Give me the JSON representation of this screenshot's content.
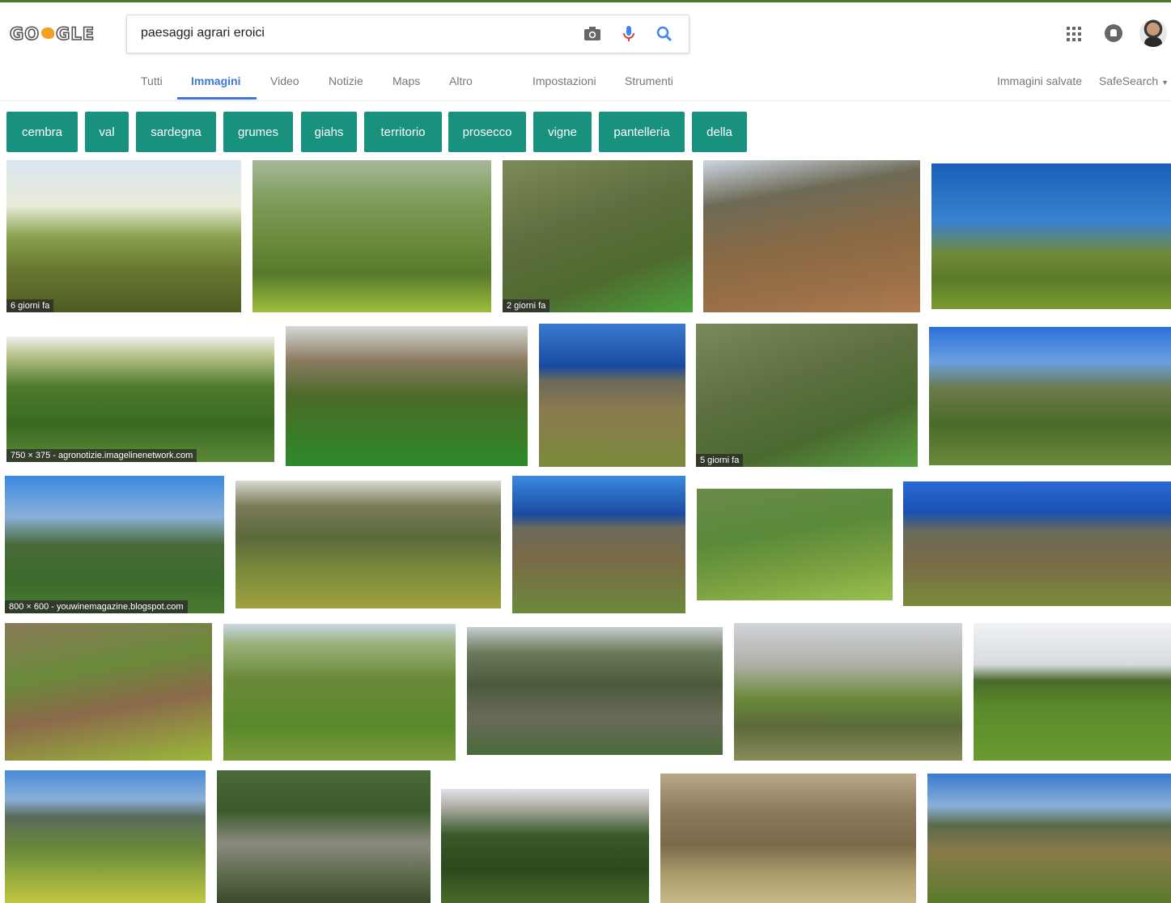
{
  "logo": {
    "text": "GO GLE"
  },
  "search": {
    "query": "paesaggi agrari eroici"
  },
  "tabs": {
    "tutti": "Tutti",
    "immagini": "Immagini",
    "video": "Video",
    "notizie": "Notizie",
    "maps": "Maps",
    "altro": "Altro",
    "impostazioni": "Impostazioni",
    "strumenti": "Strumenti",
    "immagini_salvate": "Immagini salvate",
    "safesearch": "SafeSearch"
  },
  "chips": [
    "cembra",
    "val",
    "sardegna",
    "grumes",
    "giahs",
    "territorio",
    "prosecco",
    "vigne",
    "pantelleria",
    "della"
  ],
  "captions": {
    "c1": "6 giorni fa",
    "c3": "2 giorni fa",
    "c6": "750 × 375 - agronotizie.imagelinenetwork.com",
    "c9": "5 giorni fa",
    "c11": "800 × 600 - youwinemagazine.blogspot.com"
  },
  "colors": {
    "chip_bg": "#18917e",
    "active_tab": "#3c78d8"
  }
}
